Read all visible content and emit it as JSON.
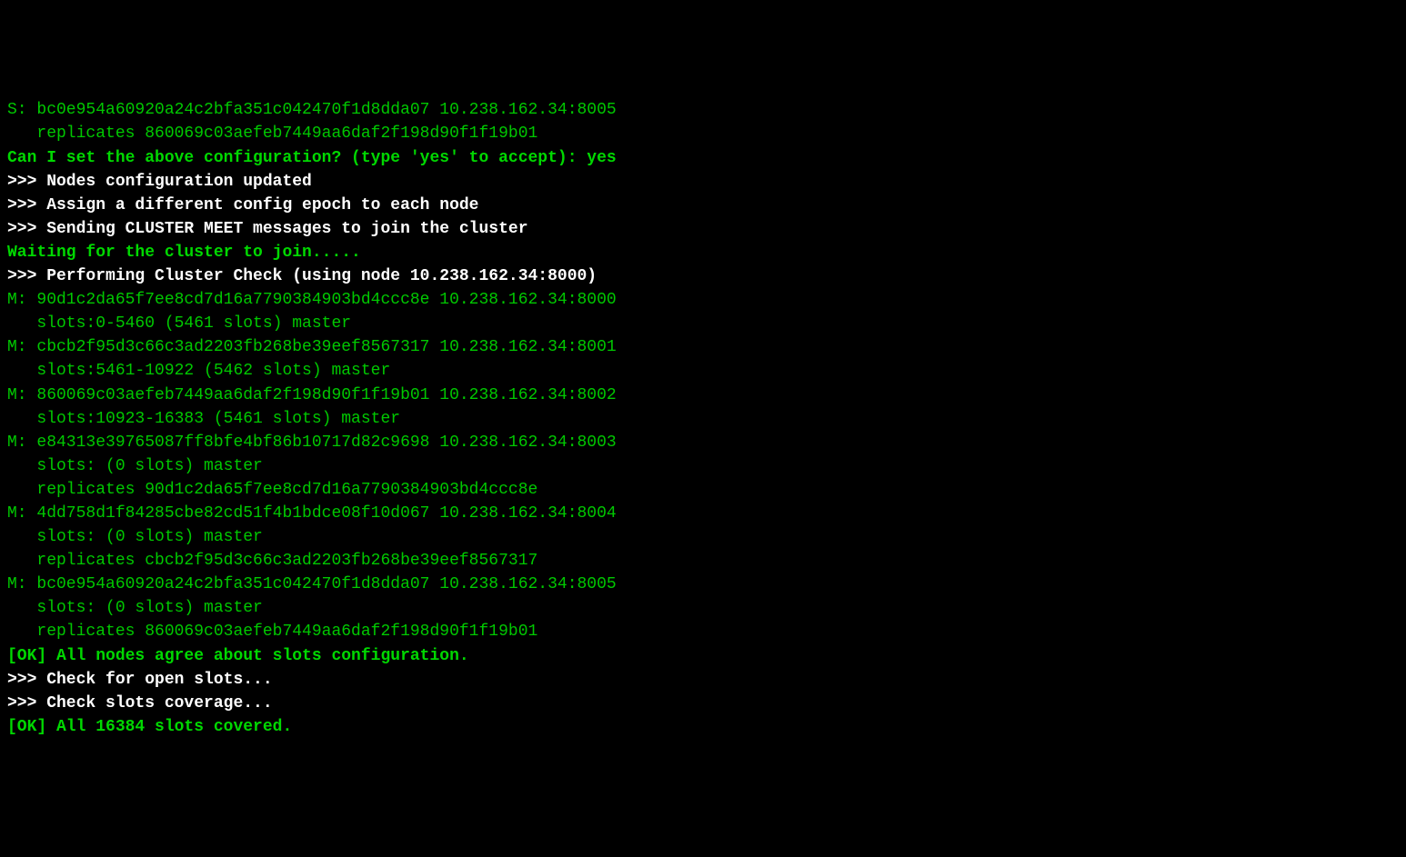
{
  "lines": [
    {
      "style": "green",
      "text": "S: bc0e954a60920a24c2bfa351c042470f1d8dda07 10.238.162.34:8005"
    },
    {
      "style": "green",
      "text": "   replicates 860069c03aefeb7449aa6daf2f198d90f1f19b01"
    },
    {
      "style": "green-bold",
      "text": "Can I set the above configuration? (type 'yes' to accept): yes"
    },
    {
      "style": "white-bold",
      "text": ">>> Nodes configuration updated"
    },
    {
      "style": "white-bold",
      "text": ">>> Assign a different config epoch to each node"
    },
    {
      "style": "white-bold",
      "text": ">>> Sending CLUSTER MEET messages to join the cluster"
    },
    {
      "style": "green-bold",
      "text": "Waiting for the cluster to join....."
    },
    {
      "style": "white-bold",
      "text": ">>> Performing Cluster Check (using node 10.238.162.34:8000)"
    },
    {
      "style": "green",
      "text": "M: 90d1c2da65f7ee8cd7d16a7790384903bd4ccc8e 10.238.162.34:8000"
    },
    {
      "style": "green",
      "text": "   slots:0-5460 (5461 slots) master"
    },
    {
      "style": "green",
      "text": "M: cbcb2f95d3c66c3ad2203fb268be39eef8567317 10.238.162.34:8001"
    },
    {
      "style": "green",
      "text": "   slots:5461-10922 (5462 slots) master"
    },
    {
      "style": "green",
      "text": "M: 860069c03aefeb7449aa6daf2f198d90f1f19b01 10.238.162.34:8002"
    },
    {
      "style": "green",
      "text": "   slots:10923-16383 (5461 slots) master"
    },
    {
      "style": "green",
      "text": "M: e84313e39765087ff8bfe4bf86b10717d82c9698 10.238.162.34:8003"
    },
    {
      "style": "green",
      "text": "   slots: (0 slots) master"
    },
    {
      "style": "green",
      "text": "   replicates 90d1c2da65f7ee8cd7d16a7790384903bd4ccc8e"
    },
    {
      "style": "green",
      "text": "M: 4dd758d1f84285cbe82cd51f4b1bdce08f10d067 10.238.162.34:8004"
    },
    {
      "style": "green",
      "text": "   slots: (0 slots) master"
    },
    {
      "style": "green",
      "text": "   replicates cbcb2f95d3c66c3ad2203fb268be39eef8567317"
    },
    {
      "style": "green",
      "text": "M: bc0e954a60920a24c2bfa351c042470f1d8dda07 10.238.162.34:8005"
    },
    {
      "style": "green",
      "text": "   slots: (0 slots) master"
    },
    {
      "style": "green",
      "text": "   replicates 860069c03aefeb7449aa6daf2f198d90f1f19b01"
    },
    {
      "style": "green-bold",
      "text": "[OK] All nodes agree about slots configuration."
    },
    {
      "style": "white-bold",
      "text": ">>> Check for open slots..."
    },
    {
      "style": "white-bold",
      "text": ">>> Check slots coverage..."
    },
    {
      "style": "green-bold",
      "text": "[OK] All 16384 slots covered."
    }
  ]
}
